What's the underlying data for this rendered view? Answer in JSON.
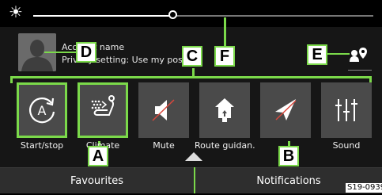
{
  "brightness": {
    "level": 0.41
  },
  "profile": {
    "name_label": "Account name",
    "setting_label": "Privacy setting: Use my position"
  },
  "tiles": [
    {
      "label": "Start/stop",
      "icon": "auto-start-stop-icon",
      "selected": true
    },
    {
      "label": "Climate",
      "icon": "seat-climate-icon",
      "selected": true
    },
    {
      "label": "Mute",
      "icon": "mute-icon",
      "selected": false
    },
    {
      "label": "Route guidan...",
      "icon": "route-guidance-mute-icon",
      "selected": false
    },
    {
      "label": "",
      "icon": "navigation-arrow-muted-icon",
      "selected": false
    },
    {
      "label": "Sound",
      "icon": "equalizer-icon",
      "selected": false
    }
  ],
  "tabs": {
    "favourites": "Favourites",
    "notifications": "Notifications"
  },
  "callouts": {
    "a": "A",
    "b": "B",
    "c": "C",
    "d": "D",
    "e": "E",
    "f": "F"
  },
  "figure_code": "S19-0939",
  "colors": {
    "accent": "#7bd94a",
    "tile": "#4a4a4a",
    "mute_slash": "#d9473c"
  }
}
